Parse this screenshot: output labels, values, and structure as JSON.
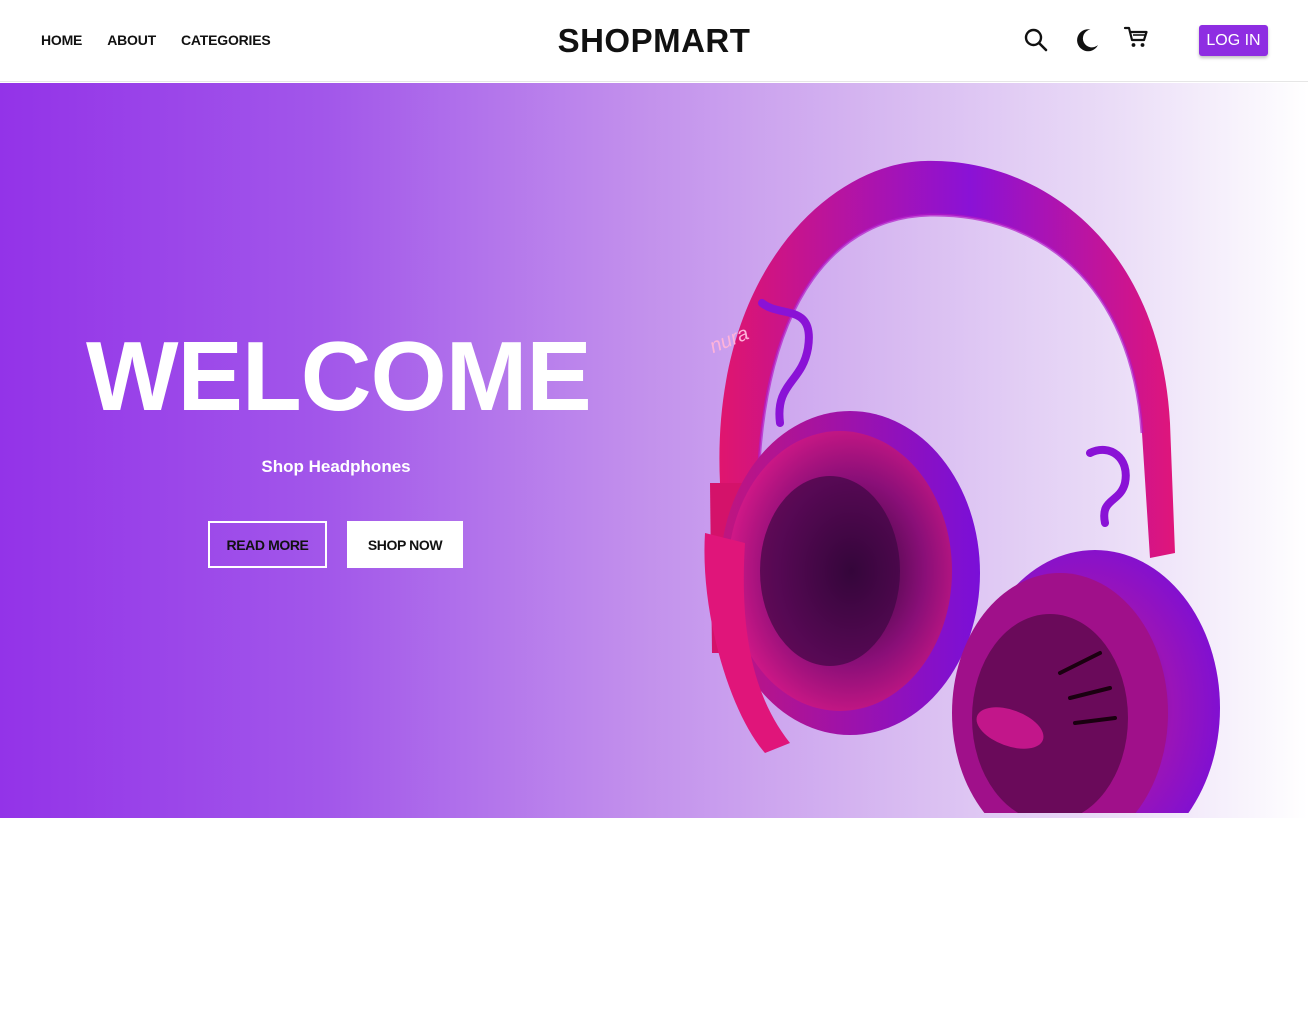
{
  "header": {
    "nav": [
      {
        "label": "HOME"
      },
      {
        "label": "ABOUT"
      },
      {
        "label": "CATEGORIES"
      }
    ],
    "logo": "SHOPMART",
    "icons": [
      "search-icon",
      "moon-icon",
      "cart-icon"
    ],
    "login_label": "LOG IN"
  },
  "hero": {
    "title": "WELCOME",
    "subtitle": "Shop Headphones",
    "read_more_label": "READ MORE",
    "shop_now_label": "SHOP NOW",
    "image_brand": "nura"
  },
  "colors": {
    "accent": "#8e2de2",
    "hero_start": "#9333e8",
    "hero_end": "#ffffff",
    "headphone_pink": "#e0156e",
    "headphone_purple": "#7a0fd8"
  }
}
